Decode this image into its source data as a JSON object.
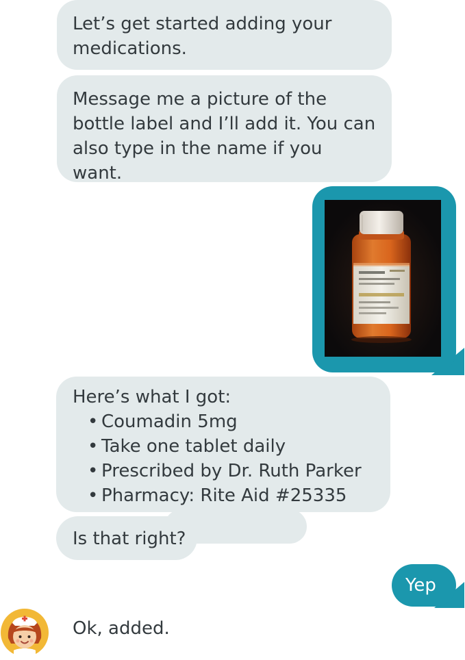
{
  "messages": {
    "intro": "Let’s get started adding your medications.",
    "instructions": "Message me a picture of the bottle label and I’ll add it. You can also type in the name if you want.",
    "result_header": "Here’s what I got:",
    "result_items": [
      "Coumadin 5mg",
      "Take one tablet daily",
      "Prescribed by Dr. Ruth Parker",
      "Pharmacy: Rite Aid #25335"
    ],
    "confirm_question": "Is that right?",
    "user_reply": "Yep",
    "final": "Ok, added."
  },
  "colors": {
    "bot_bubble": "#e3eaeb",
    "user_bubble": "#1b97ad",
    "text": "#333a3e"
  },
  "icons": {
    "avatar": "nurse-avatar-icon",
    "photo": "pill-bottle-photo"
  }
}
